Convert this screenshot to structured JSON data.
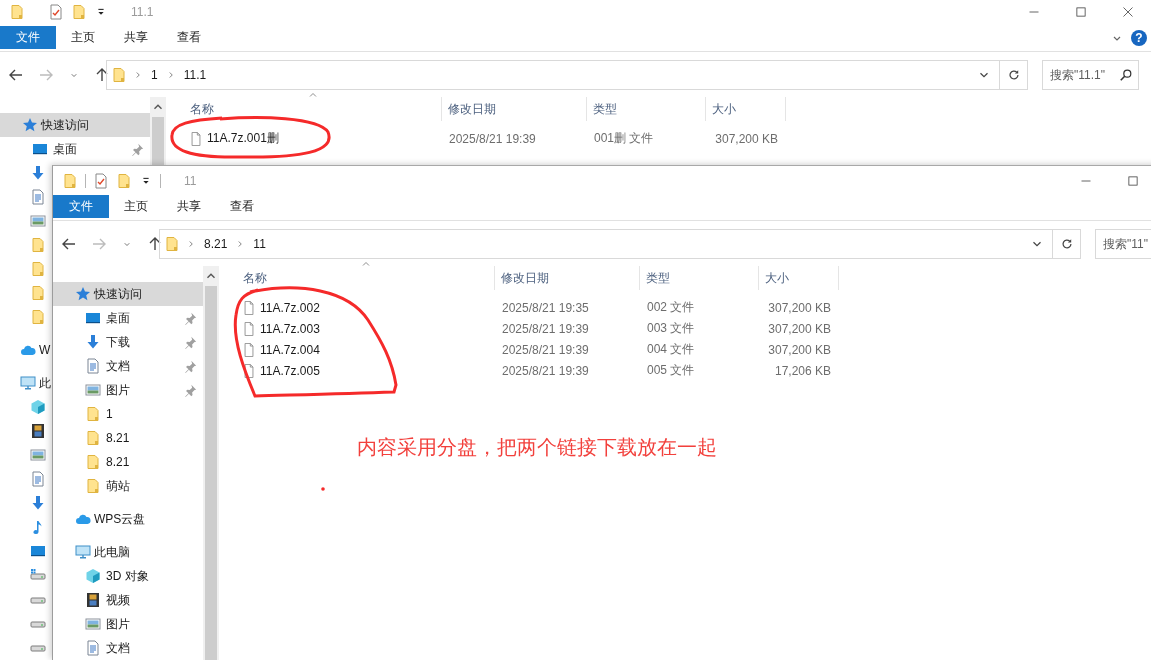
{
  "back_window": {
    "title": "11.1",
    "ribbon_tabs": [
      {
        "label": "文件",
        "kind": "file-menu"
      },
      {
        "label": "主页",
        "kind": "tab"
      },
      {
        "label": "共享",
        "kind": "tab"
      },
      {
        "label": "查看",
        "kind": "tab"
      }
    ],
    "help": "?",
    "nav": {
      "back_disabled": false,
      "forward_disabled": true
    },
    "path": [
      "1",
      "11.1"
    ],
    "search": {
      "placeholder": "搜索\"11.1\""
    },
    "sidebar": [
      {
        "kind": "star",
        "label": "快速访问",
        "selected": true,
        "children": [
          {
            "kind": "desktop",
            "label": "桌面",
            "pinned": true,
            "selected": false
          },
          {
            "kind": "download",
            "selected": false
          },
          {
            "kind": "documents",
            "selected": false
          },
          {
            "kind": "pictures",
            "selected": false
          },
          {
            "kind": "folder",
            "selected": false
          },
          {
            "kind": "folder",
            "selected": false
          },
          {
            "kind": "folder",
            "selected": false
          },
          {
            "kind": "folder",
            "selected": false
          }
        ]
      },
      {
        "kind": "cloud",
        "label": "W",
        "selected": false
      },
      {
        "kind": "computer",
        "label": "此",
        "selected": false,
        "children": [
          {
            "kind": "cube",
            "selected": false
          },
          {
            "kind": "film",
            "selected": false
          },
          {
            "kind": "pictures",
            "selected": false
          },
          {
            "kind": "documents",
            "selected": false
          },
          {
            "kind": "download",
            "selected": false
          },
          {
            "kind": "music",
            "selected": false
          },
          {
            "kind": "desktop",
            "selected": false
          },
          {
            "kind": "windrive",
            "selected": false
          },
          {
            "kind": "drive",
            "selected": false
          },
          {
            "kind": "drive",
            "selected": false
          },
          {
            "kind": "drive",
            "selected": false
          }
        ]
      }
    ],
    "columns": [
      {
        "label": "名称",
        "sorted": true
      },
      {
        "label": "修改日期",
        "sorted": false
      },
      {
        "label": "类型",
        "sorted": false
      },
      {
        "label": "大小",
        "sorted": false
      }
    ],
    "rows": [
      {
        "name": "11A.7z.001删",
        "modified": "2025/8/21 19:39",
        "type": "001删 文件",
        "size": "307,200 KB"
      }
    ]
  },
  "front_window": {
    "title": "11",
    "ribbon_tabs": [
      {
        "label": "文件",
        "kind": "file-menu"
      },
      {
        "label": "主页",
        "kind": "tab"
      },
      {
        "label": "共享",
        "kind": "tab"
      },
      {
        "label": "查看",
        "kind": "tab"
      }
    ],
    "nav": {
      "back_disabled": false,
      "forward_disabled": true
    },
    "path": [
      "8.21",
      "11"
    ],
    "search": {
      "placeholder": "搜索\"11\""
    },
    "sidebar": [
      {
        "kind": "star",
        "label": "快速访问",
        "selected": true,
        "children": [
          {
            "kind": "desktop",
            "label": "桌面",
            "pinned": true,
            "selected": false
          },
          {
            "kind": "download",
            "label": "下载",
            "pinned": true,
            "selected": false
          },
          {
            "kind": "documents",
            "label": "文档",
            "pinned": true,
            "selected": false
          },
          {
            "kind": "pictures",
            "label": "图片",
            "pinned": true,
            "selected": false
          },
          {
            "kind": "folder",
            "label": "1",
            "pinned": false,
            "selected": false
          },
          {
            "kind": "folder",
            "label": "8.21",
            "pinned": false,
            "selected": false
          },
          {
            "kind": "folder",
            "label": "8.21",
            "pinned": false,
            "selected": false
          },
          {
            "kind": "folder",
            "label": "萌站",
            "pinned": false,
            "selected": false
          }
        ]
      },
      {
        "kind": "cloud",
        "label": "WPS云盘",
        "selected": false
      },
      {
        "kind": "computer",
        "label": "此电脑",
        "selected": false,
        "children": [
          {
            "kind": "cube",
            "label": "3D 对象",
            "selected": false
          },
          {
            "kind": "film",
            "label": "视频",
            "selected": false
          },
          {
            "kind": "pictures",
            "label": "图片",
            "selected": false
          },
          {
            "kind": "documents",
            "label": "文档",
            "selected": false
          }
        ]
      }
    ],
    "columns": [
      {
        "label": "名称",
        "sorted": true
      },
      {
        "label": "修改日期",
        "sorted": false
      },
      {
        "label": "类型",
        "sorted": false
      },
      {
        "label": "大小",
        "sorted": false
      }
    ],
    "rows": [
      {
        "name": "11A.7z.002",
        "modified": "2025/8/21 19:35",
        "type": "002 文件",
        "size": "307,200 KB"
      },
      {
        "name": "11A.7z.003",
        "modified": "2025/8/21 19:39",
        "type": "003 文件",
        "size": "307,200 KB"
      },
      {
        "name": "11A.7z.004",
        "modified": "2025/8/21 19:39",
        "type": "004 文件",
        "size": "307,200 KB"
      },
      {
        "name": "11A.7z.005",
        "modified": "2025/8/21 19:39",
        "type": "005 文件",
        "size": "17,206 KB"
      }
    ]
  },
  "annotation": {
    "text": "内容采用分盘，把两个链接下载放在一起"
  }
}
